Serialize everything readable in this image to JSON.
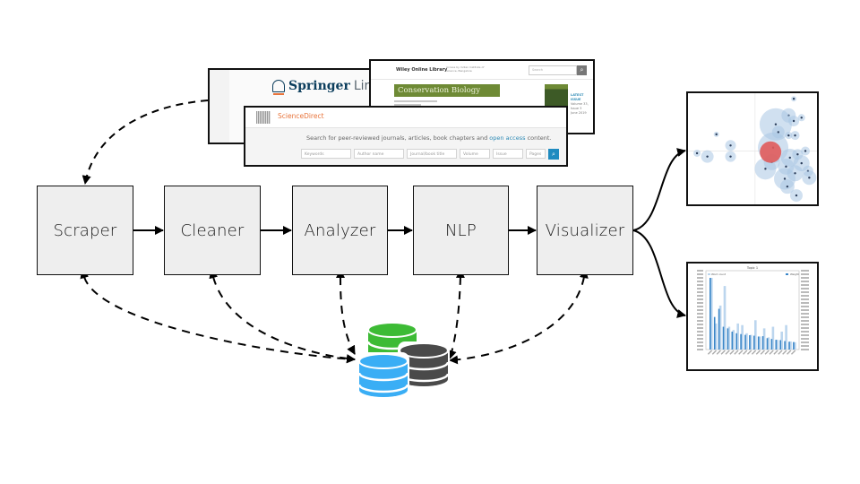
{
  "stages": [
    {
      "id": "scraper",
      "label": "Scraper"
    },
    {
      "id": "cleaner",
      "label": "Cleaner"
    },
    {
      "id": "analyzer",
      "label": "Analyzer"
    },
    {
      "id": "nlp",
      "label": "NLP"
    },
    {
      "id": "visualizer",
      "label": "Visualizer"
    }
  ],
  "sources": {
    "springer": {
      "brand": "Springer",
      "suffix": "Link"
    },
    "sciencedirect": {
      "brand": "ScienceDirect",
      "tagline_pre": "Search for peer-reviewed journals, articles, book chapters and ",
      "tagline_link": "open access",
      "tagline_post": " content.",
      "fields": [
        "Keywords",
        "Author name",
        "Journal/book title",
        "Volume",
        "Issue",
        "Pages"
      ]
    },
    "wiley": {
      "brand": "Wiley Online Library",
      "access_note": "Access by Indian Institute of Science, Bangalore",
      "search_placeholder": "Search",
      "journal": "Conservation Biology",
      "latest_label": "LATEST ISSUE",
      "latest_detail": "Volume 33, Issue 3",
      "latest_date": "June 2019"
    }
  },
  "storage": {
    "databases": [
      {
        "name": "green-db",
        "color": "#3dbb35"
      },
      {
        "name": "dark-db",
        "color": "#4a4a4a"
      },
      {
        "name": "blue-db",
        "color": "#3aaef5"
      }
    ]
  },
  "outputs": {
    "bubble_chart": {
      "colors": {
        "bubble": "#a9c6e4",
        "highlight": "#e05b5b"
      },
      "bubbles": [
        [
          0.82,
          0.05,
          3
        ],
        [
          0.78,
          0.2,
          8
        ],
        [
          0.82,
          0.25,
          6
        ],
        [
          0.68,
          0.28,
          18
        ],
        [
          0.7,
          0.35,
          7
        ],
        [
          0.88,
          0.22,
          4
        ],
        [
          0.83,
          0.38,
          5
        ],
        [
          0.78,
          0.38,
          4
        ],
        [
          0.22,
          0.37,
          3
        ],
        [
          0.33,
          0.47,
          6
        ],
        [
          0.33,
          0.57,
          6
        ],
        [
          0.15,
          0.57,
          7
        ],
        [
          0.07,
          0.54,
          4
        ],
        [
          0.66,
          0.49,
          17
        ],
        [
          0.65,
          0.62,
          9
        ],
        [
          0.6,
          0.68,
          12
        ],
        [
          0.79,
          0.58,
          10
        ],
        [
          0.85,
          0.55,
          6
        ],
        [
          0.88,
          0.63,
          9
        ],
        [
          0.76,
          0.66,
          9
        ],
        [
          0.83,
          0.72,
          9
        ],
        [
          0.93,
          0.7,
          6
        ],
        [
          0.94,
          0.76,
          8
        ],
        [
          0.75,
          0.77,
          12
        ],
        [
          0.77,
          0.84,
          8
        ],
        [
          0.84,
          0.92,
          7
        ],
        [
          0.91,
          0.52,
          5
        ]
      ]
    },
    "bar_chart": {
      "type": "bar",
      "title": "Topic 1",
      "legend": [
        "Word count",
        "Weight"
      ],
      "ylabel_left": "Word count",
      "ylabel_right": "Weight",
      "colors": {
        "word_count": "#bcd6ee",
        "weight": "#3a86c8"
      },
      "word_count": [
        4400,
        1600,
        2700,
        3900,
        1400,
        1200,
        1600,
        1500,
        1000,
        900,
        1800,
        800,
        1300,
        750,
        1400,
        600,
        1100,
        1500,
        500,
        450
      ],
      "weight": [
        4400,
        2000,
        2500,
        1400,
        1300,
        1100,
        1000,
        950,
        900,
        880,
        850,
        800,
        820,
        700,
        650,
        600,
        580,
        520,
        480,
        460
      ],
      "ylim": [
        0,
        4400
      ]
    }
  }
}
